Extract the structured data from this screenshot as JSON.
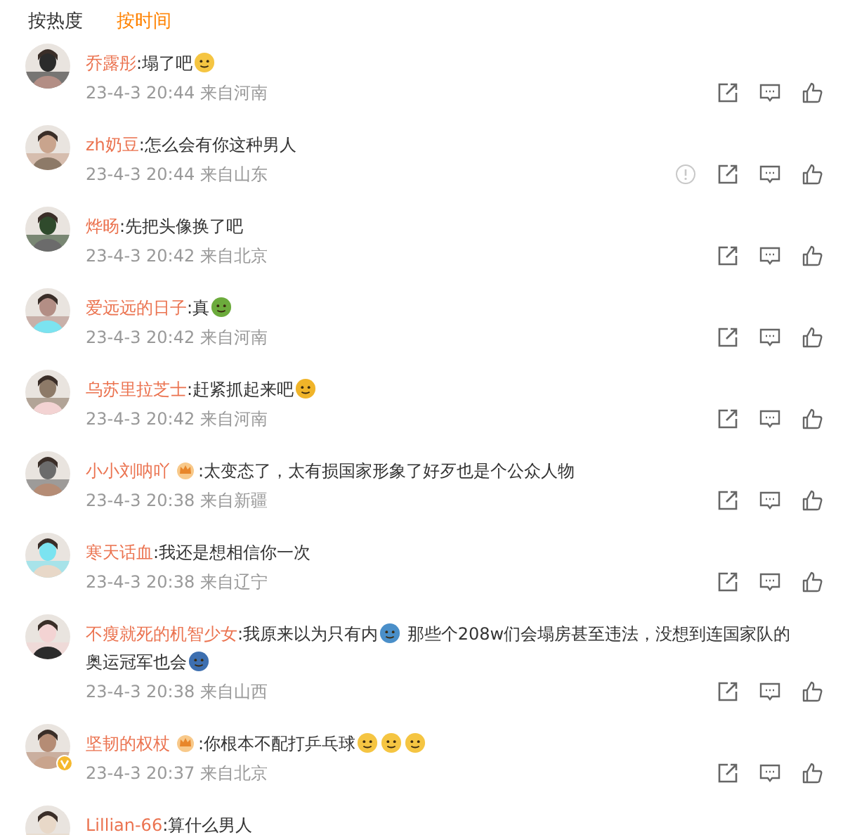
{
  "tabs": [
    {
      "label": "按热度",
      "selected": false
    },
    {
      "label": "按时间",
      "selected": true
    }
  ],
  "comments": [
    {
      "name": "乔露彤",
      "parts": [
        {
          "kind": "text",
          "text": ":塌了吧"
        },
        {
          "kind": "emoji",
          "color": "#f5c542"
        }
      ],
      "time": "23-4-3 20:44 来自河南"
    },
    {
      "name": "zh奶豆",
      "parts": [
        {
          "kind": "text",
          "text": ":怎么会有你这种男人"
        }
      ],
      "time": "23-4-3 20:44 来自山东",
      "report": true
    },
    {
      "name": "烨旸",
      "parts": [
        {
          "kind": "text",
          "text": ":先把头像换了吧"
        }
      ],
      "time": "23-4-3 20:42 来自北京"
    },
    {
      "name": "爱远远的日子",
      "parts": [
        {
          "kind": "text",
          "text": ":真"
        },
        {
          "kind": "emoji",
          "color": "#6cab3c"
        }
      ],
      "time": "23-4-3 20:42 来自河南"
    },
    {
      "name": "乌苏里拉芝士",
      "parts": [
        {
          "kind": "text",
          "text": ":赶紧抓起来吧"
        },
        {
          "kind": "emoji",
          "color": "#f0b429"
        }
      ],
      "time": "23-4-3 20:42 来自河南"
    },
    {
      "name": "小小刘呐吖",
      "badge": true,
      "parts": [
        {
          "kind": "text",
          "text": ":太变态了，太有损国家形象了好歹也是个公众人物"
        }
      ],
      "time": "23-4-3 20:38 来自新疆"
    },
    {
      "name": "寒天话血",
      "parts": [
        {
          "kind": "text",
          "text": ":我还是想相信你一次"
        }
      ],
      "time": "23-4-3 20:38 来自辽宁"
    },
    {
      "name": "不瘦就死的机智少女",
      "parts": [
        {
          "kind": "text",
          "text": ":我原来以为只有内"
        },
        {
          "kind": "emoji",
          "color": "#4a8fc9"
        },
        {
          "kind": "text",
          "text": " 那些个208w们会塌房甚至违法，没想到连国家队的"
        },
        {
          "kind": "break"
        },
        {
          "kind": "text",
          "text": "奥运冠军也会"
        },
        {
          "kind": "emoji",
          "color": "#3d6fb0"
        }
      ],
      "time": "23-4-3 20:38 来自山西"
    },
    {
      "name": "坚韧的权杖",
      "badge": true,
      "verified": true,
      "parts": [
        {
          "kind": "text",
          "text": ":你根本不配打乒乓球"
        },
        {
          "kind": "emoji",
          "color": "#f5c542"
        },
        {
          "kind": "emoji",
          "color": "#f5c542"
        },
        {
          "kind": "emoji",
          "color": "#f5c542"
        }
      ],
      "time": "23-4-3 20:37 来自北京"
    },
    {
      "name": "Lillian-66",
      "parts": [
        {
          "kind": "text",
          "text": ":算什么男人"
        }
      ]
    }
  ]
}
